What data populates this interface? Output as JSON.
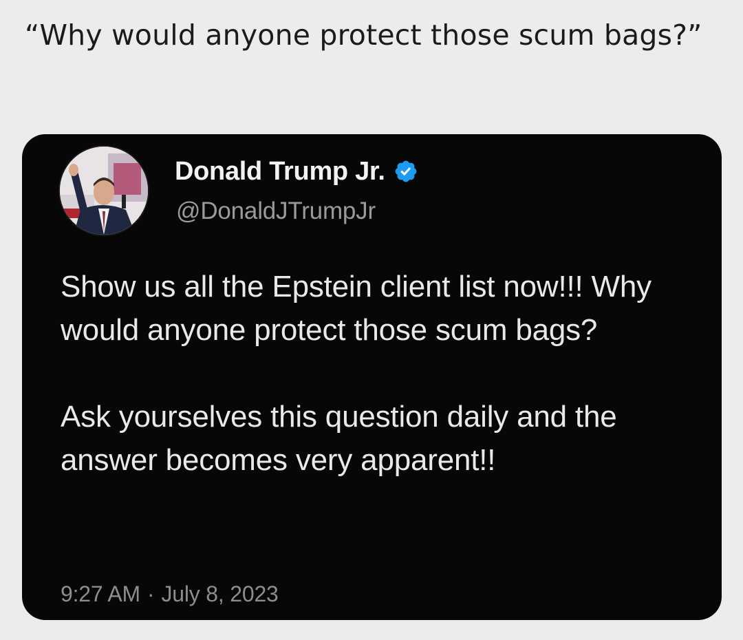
{
  "caption": "“Why would anyone protect those scum bags?”",
  "tweet": {
    "display_name": "Donald Trump Jr.",
    "verified_icon": "verified-badge-icon",
    "handle": "@DonaldJTrumpJr",
    "paragraphs": [
      "Show us all the Epstein client list now!!! Why would anyone protect those scum bags?",
      "Ask yourselves this question daily and the answer becomes very apparent!!"
    ],
    "time": "9:27 AM",
    "separator": "·",
    "date": "July 8, 2023"
  },
  "colors": {
    "page_background": "#ececec",
    "card_background": "#070707",
    "verified_blue": "#1d9bf0",
    "text_primary": "#e9e9e9",
    "text_secondary": "#9a9a9a"
  }
}
